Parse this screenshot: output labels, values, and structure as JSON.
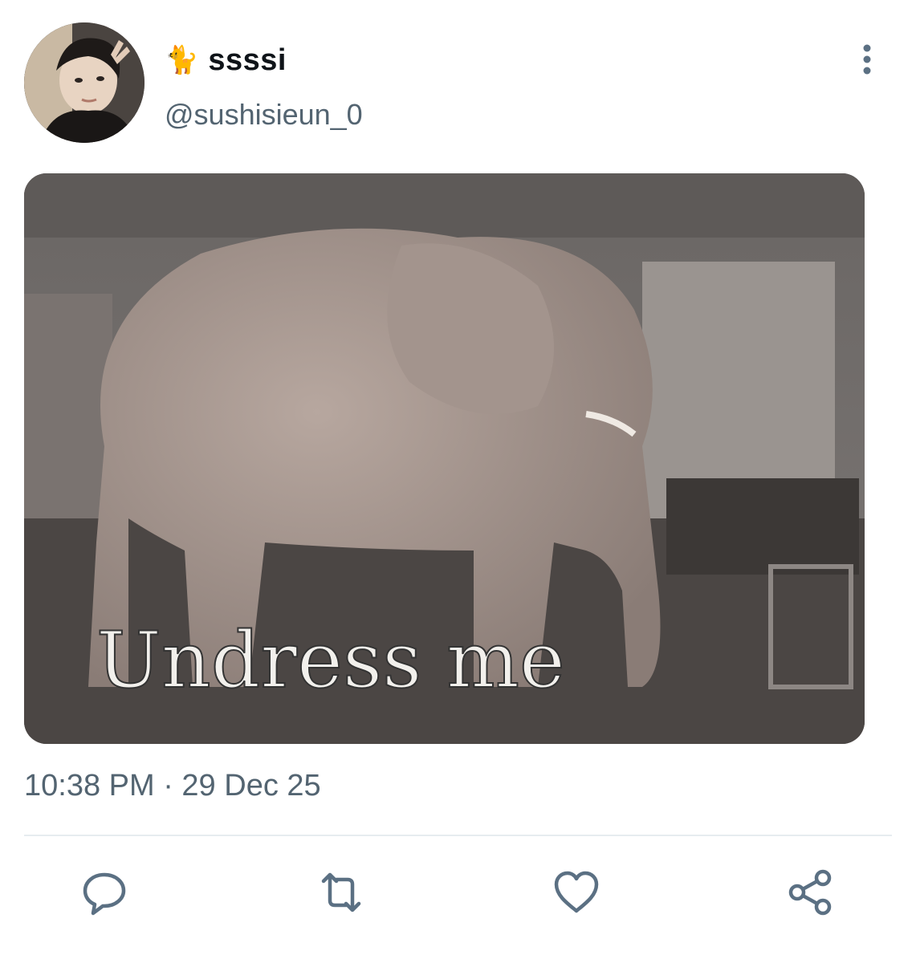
{
  "author": {
    "emoji": "🐈",
    "display_name": "ssssi",
    "handle": "@sushisieun_0"
  },
  "media": {
    "caption": "Undress me"
  },
  "timestamp": "10:38 PM · 29 Dec 25",
  "icons": {
    "more": "more-vertical-icon",
    "reply": "comment-icon",
    "retweet": "retweet-icon",
    "like": "heart-icon",
    "share": "share-icon"
  },
  "colors": {
    "text": "#0f1419",
    "secondary": "#536471",
    "icon": "#5b7083",
    "divider": "#e6ecf0"
  }
}
